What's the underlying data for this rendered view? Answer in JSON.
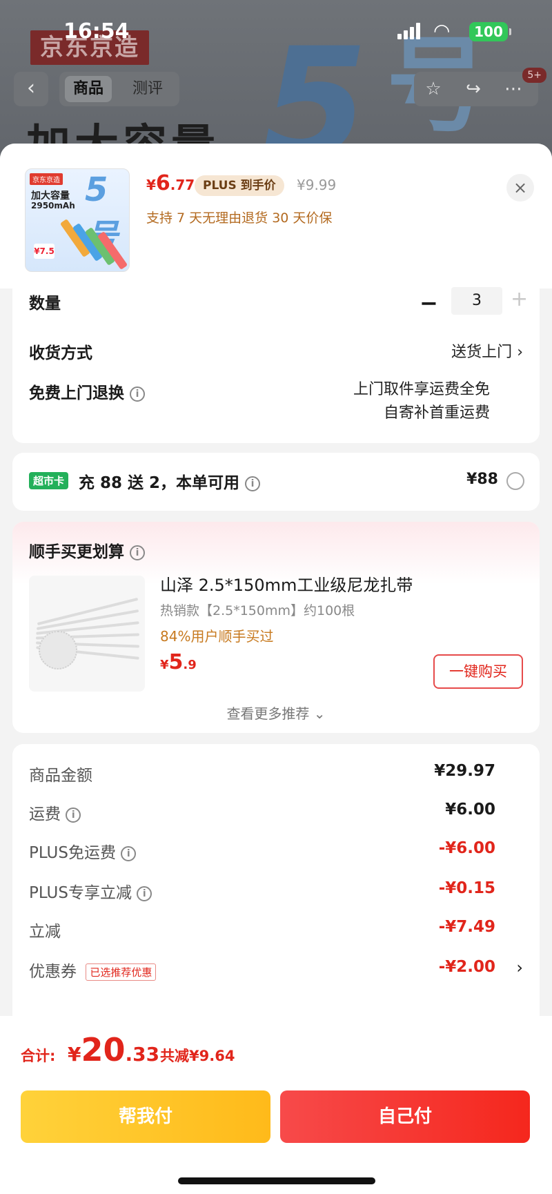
{
  "status": {
    "time": "16:54",
    "battery": "100"
  },
  "background": {
    "brand": "京东京造",
    "big_number": "5",
    "big_char": "号",
    "heading": "加大容量",
    "tabs": [
      "商品",
      "测评"
    ],
    "badge": "5+"
  },
  "product": {
    "thumb": {
      "logo": "京东京造",
      "title": "加大容量",
      "capacity": "2950mAh",
      "number": "5号",
      "price_tag": "¥7.5"
    },
    "price_yen": "¥",
    "price_int": "6",
    "price_dec": ".77",
    "plus_tag": "PLUS 到手价",
    "original_price": "¥9.99",
    "promise": "支持 7 天无理由退货   30 天价保"
  },
  "options": {
    "quantity_label": "数量",
    "quantity_value": "3",
    "delivery_label": "收货方式",
    "delivery_value": "送货上门",
    "return_label": "免费上门退换",
    "return_line1": "上门取件享运费全免",
    "return_line2": "自寄补首重运费"
  },
  "supermarket": {
    "badge": "超市卡",
    "text": "充 88 送 2，本单可用",
    "price": "¥88"
  },
  "recommend": {
    "title": "顺手买更划算",
    "item_name": "山泽 2.5*150mm工业级尼龙扎带",
    "item_spec": "热销款【2.5*150mm】约100根",
    "item_social": "84%用户顺手买过",
    "price_yen": "¥",
    "price_int": "5",
    "price_dec": ".9",
    "buy_label": "一键购买",
    "more_label": "查看更多推荐"
  },
  "summary": {
    "rows": [
      {
        "label": "商品金额",
        "value": "¥29.97"
      },
      {
        "label": "运费",
        "value": "¥6.00"
      },
      {
        "label": "PLUS免运费",
        "value": "-¥6.00"
      },
      {
        "label": "PLUS专享立减",
        "value": "-¥0.15"
      },
      {
        "label": "立减",
        "value": "-¥7.49"
      },
      {
        "label": "优惠券",
        "value": "-¥2.00",
        "tag": "已选推荐优惠"
      }
    ]
  },
  "footer": {
    "total_label": "合计:",
    "total_yen": "¥",
    "total_int": "20",
    "total_dec": ".33",
    "saved": "共减¥9.64",
    "help_pay": "帮我付",
    "self_pay": "自己付"
  },
  "colors": {
    "accent_red": "#e1251b",
    "yellow": "#ffc72a",
    "green_badge": "#23b05a"
  }
}
